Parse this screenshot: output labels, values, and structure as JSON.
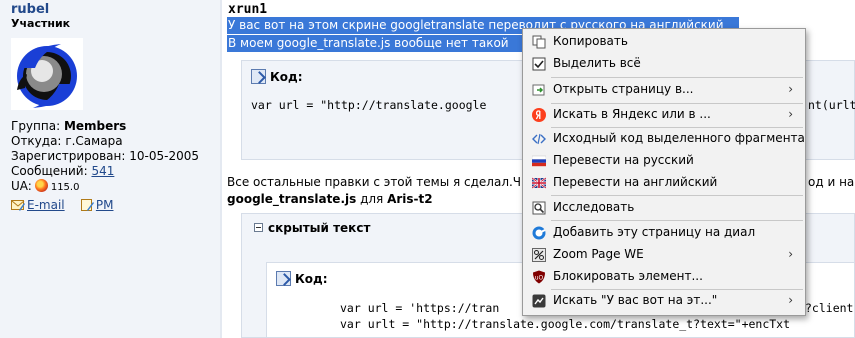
{
  "user": {
    "name": "rubel",
    "rank": "Участник",
    "group_label": "Группа:",
    "group_value": "Members",
    "location_label": "Откуда:",
    "location_value": "г.Самара",
    "registered_label": "Зарегистрирован:",
    "registered_value": "10-05-2005",
    "messages_label": "Сообщений:",
    "messages_value": "541",
    "ua_label": "UA:",
    "ua_version": "115.0",
    "email_label": "E-mail",
    "pm_label": "PM"
  },
  "post": {
    "author": "xrun1",
    "selected_line1": "У вас вот на этом скрине googletranslate переводит с русского на английский",
    "selected_line2": "В моем google_translate.js вообще нет такой",
    "code1_label": "Код:",
    "code1_line": "var url = \"http://translate.google",
    "code1_tail": "nt(urlt",
    "text_line1": "Все остальные правки с этой темы я сделал.Ч",
    "text_line1_tail": "од и на а",
    "text_line2_file": "google_translate.js",
    "text_line2_mid": " для ",
    "text_line2_target": "Aris-t2",
    "spoiler_label": "скрытый текст",
    "code2_label": "Код:",
    "code2_line1": "var url = 'https://tran",
    "code2_line1_tail": "?client",
    "code2_line2": "var urlt = \"http://translate.google.com/translate_t?text=\"+encTxt"
  },
  "context_menu": {
    "items": [
      {
        "label": "Копировать",
        "icon": "copy-icon"
      },
      {
        "label": "Выделить всё",
        "icon": "select-all-icon"
      },
      {
        "label": "Открыть страницу в...",
        "icon": "open-page-icon",
        "arrow": "›"
      },
      {
        "label": "Искать в Яндекс или в ...",
        "icon": "yandex-icon",
        "arrow": "›"
      },
      {
        "label": "Исходный код выделенного фрагмента",
        "icon": "source-code-icon"
      },
      {
        "label": "Перевести на русский",
        "icon": "russian-flag-icon"
      },
      {
        "label": "Перевести на английский",
        "icon": "uk-flag-icon"
      },
      {
        "label": "Исследовать",
        "icon": "inspect-icon"
      },
      {
        "label": "Добавить эту страницу на диал",
        "icon": "speed-dial-icon"
      },
      {
        "label": "Zoom Page WE",
        "icon": "zoom-icon",
        "arrow": "›"
      },
      {
        "label": "Блокировать элемент...",
        "icon": "ublock-icon"
      },
      {
        "label": "Искать \"У вас вот на эт...\"",
        "icon": "search-icon",
        "arrow": "›"
      }
    ]
  },
  "colors": {
    "selection": "#3a78d8",
    "link": "#22498b",
    "panel": "#f1f4f9"
  }
}
